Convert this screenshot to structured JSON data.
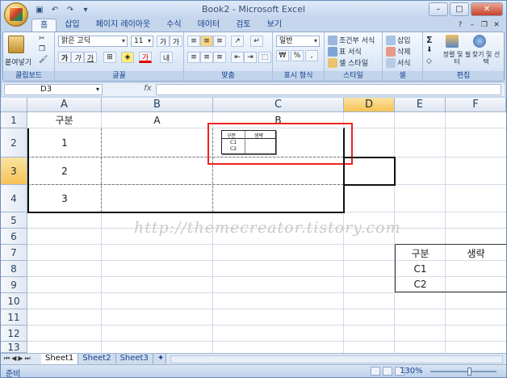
{
  "window": {
    "title": "Book2 - Microsoft Excel"
  },
  "tabs": [
    "홈",
    "삽입",
    "페이지 레이아웃",
    "수식",
    "데이터",
    "검토",
    "보기"
  ],
  "ribbon": {
    "groups": [
      "클립보드",
      "글꼴",
      "맞춤",
      "표시 형식",
      "스타일",
      "셀",
      "편집"
    ],
    "paste_label": "붙여넣기",
    "font_name": "맑은 고딕",
    "font_size": "11",
    "number_format": "일반",
    "conditional_format": "조건부 서식",
    "table_format": "표 서식",
    "cell_style": "셀 스타일",
    "insert": "삽입",
    "delete": "삭제",
    "format": "서식",
    "sort_filter": "정렬 및 필터",
    "find_select": "찾기 및 선택"
  },
  "formula_bar": {
    "name_box": "D3",
    "fx": "fx",
    "formula": ""
  },
  "columns": [
    {
      "label": "A",
      "selected": false
    },
    {
      "label": "B",
      "selected": false
    },
    {
      "label": "C",
      "selected": false
    },
    {
      "label": "D",
      "selected": true
    },
    {
      "label": "E",
      "selected": false
    },
    {
      "label": "F",
      "selected": false
    }
  ],
  "rows": [
    "1",
    "2",
    "3",
    "4",
    "5",
    "6",
    "7",
    "8",
    "9",
    "10",
    "11",
    "12",
    "13"
  ],
  "selected_row": "3",
  "cells": {
    "A1": "구분",
    "B1": "A",
    "C1": "B",
    "A2": "1",
    "A3": "2",
    "A4": "3",
    "E7": "구분",
    "F7": "생략",
    "E8": "C1",
    "E9": "C2"
  },
  "mini_table": {
    "h1": "구분",
    "h2": "생략",
    "r1": "C1",
    "r2": "C2"
  },
  "watermark": "http://themecreator.tistory.com",
  "sheets": [
    {
      "name": "Sheet1",
      "active": true
    },
    {
      "name": "Sheet2",
      "active": false
    },
    {
      "name": "Sheet3",
      "active": false
    }
  ],
  "status": {
    "ready": "준비",
    "zoom": "130%"
  },
  "colors": {
    "accent": "#15428b",
    "selection": "#f6c355",
    "highlight_box": "#e22222"
  }
}
